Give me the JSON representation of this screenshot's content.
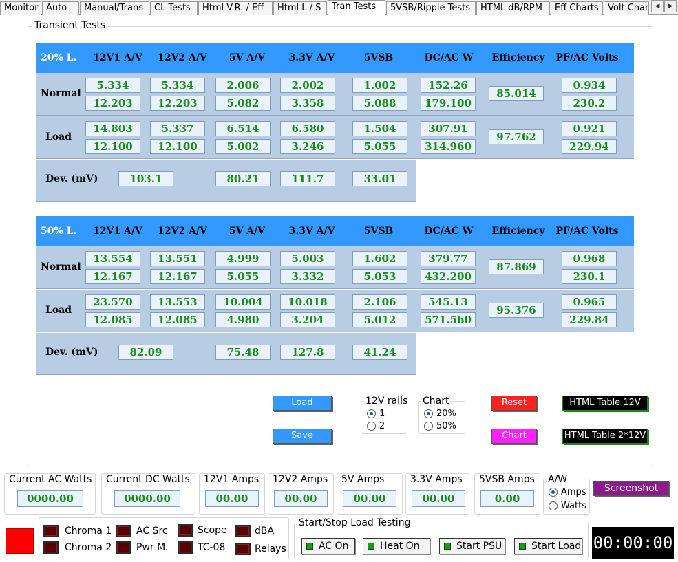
{
  "tabs": [
    "Monitor",
    "Auto",
    "Manual/Trans",
    "CL Tests",
    "Html V.R. / Eff",
    "Html L / S",
    "Tran Tests",
    "5VSB/Ripple Tests",
    "HTML dB/RPM",
    "Eff Charts",
    "Volt Chart"
  ],
  "active_tab": "Tran Tests",
  "group_title": "Transient Tests",
  "columns": [
    "12V1 A/V",
    "12V2 A/V",
    "5V A/V",
    "3.3V A/V",
    "5VSB",
    "DC/AC W",
    "Efficiency",
    "PF/AC Volts"
  ],
  "tables": [
    {
      "title": "20% L.",
      "normal": {
        "label": "Normal",
        "a": [
          "5.334",
          "5.334",
          "2.006",
          "2.002",
          "1.002",
          "152.26"
        ],
        "v": [
          "12.203",
          "12.203",
          "5.082",
          "3.358",
          "5.088",
          "179.100"
        ],
        "eff": "85.014",
        "pf": "0.934",
        "acv": "230.2"
      },
      "load": {
        "label": "Load",
        "a": [
          "14.803",
          "5.337",
          "6.514",
          "6.580",
          "1.504",
          "307.91"
        ],
        "v": [
          "12.100",
          "12.100",
          "5.002",
          "3.246",
          "5.055",
          "314.960"
        ],
        "eff": "97.762",
        "pf": "0.921",
        "acv": "229.94"
      },
      "dev": {
        "label": "Dev. (mV)",
        "values": [
          "103.1",
          "80.21",
          "111.7",
          "33.01"
        ]
      }
    },
    {
      "title": "50% L.",
      "normal": {
        "label": "Normal",
        "a": [
          "13.554",
          "13.551",
          "4.999",
          "5.003",
          "1.602",
          "379.77"
        ],
        "v": [
          "12.167",
          "12.167",
          "5.055",
          "3.332",
          "5.053",
          "432.200"
        ],
        "eff": "87.869",
        "pf": "0.968",
        "acv": "230.1"
      },
      "load": {
        "label": "Load",
        "a": [
          "23.570",
          "13.553",
          "10.004",
          "10.018",
          "2.106",
          "545.13"
        ],
        "v": [
          "12.085",
          "12.085",
          "4.980",
          "3.204",
          "5.012",
          "571.560"
        ],
        "eff": "95.376",
        "pf": "0.965",
        "acv": "229.84"
      },
      "dev": {
        "label": "Dev. (mV)",
        "values": [
          "82.09",
          "75.48",
          "127.8",
          "41.24"
        ]
      }
    }
  ],
  "controls": {
    "load_label": "Load",
    "save_label": "Save",
    "rails_title": "12V rails",
    "rails_options": [
      "1",
      "2"
    ],
    "chart_title": "Chart",
    "chart_options": [
      "20%",
      "50%"
    ],
    "reset_label": "Reset",
    "chart_label": "Chart",
    "html12_label": "HTML Table 12V",
    "html2x12_label": "HTML Table 2*12V"
  },
  "meters": [
    {
      "label": "Current AC Watts",
      "value": "0000.00"
    },
    {
      "label": "Current DC Watts",
      "value": "0000.00"
    },
    {
      "label": "12V1 Amps",
      "value": "00.00"
    },
    {
      "label": "12V2 Amps",
      "value": "00.00"
    },
    {
      "label": "5V Amps",
      "value": "00.00"
    },
    {
      "label": "3.3V Amps",
      "value": "00.00"
    },
    {
      "label": "5VSB Amps",
      "value": "0.00"
    }
  ],
  "aw": {
    "title": "A/W",
    "options": [
      "Amps",
      "Watts"
    ]
  },
  "screenshot_label": "Screenshot",
  "devices": [
    "Chroma 1",
    "Chroma 2",
    "AC Src",
    "Pwr M.",
    "Scope",
    "TC-08",
    "dBA",
    "Relays"
  ],
  "startstop": {
    "title": "Start/Stop Load Testing",
    "buttons": [
      "AC On",
      "Heat On",
      "Start PSU",
      "Start Load"
    ]
  },
  "timer": "00:00:00",
  "colors": {
    "header_blue": "#3399ff",
    "band": "#b8cce4",
    "value_green": "#1b8a1b",
    "status_red": "#ff0000",
    "reset_red": "#ff2020",
    "chart_magenta": "#ff20ff",
    "screenshot_purple": "#8b1a8b"
  }
}
